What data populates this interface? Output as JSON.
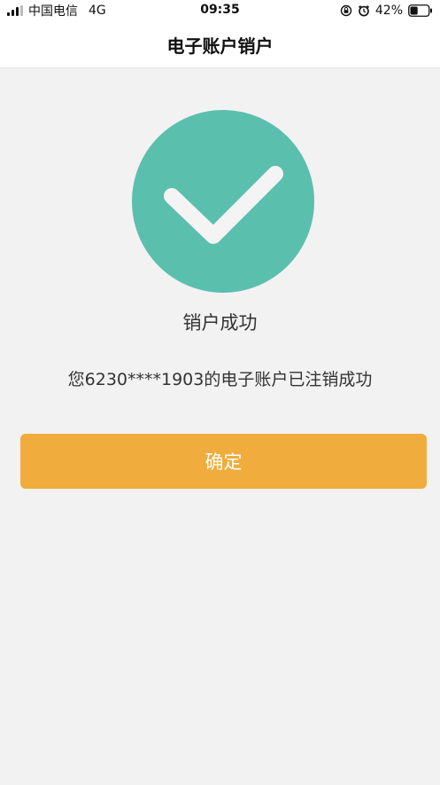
{
  "status_bar": {
    "carrier": "中国电信",
    "network": "4G",
    "time": "09:35",
    "battery_percent": "42%",
    "battery_level": 0.42,
    "icons": [
      "signal-icon",
      "rotation-lock-icon",
      "alarm-icon",
      "battery-icon"
    ]
  },
  "nav": {
    "title": "电子账户销户"
  },
  "result": {
    "icon": "check-circle-icon",
    "icon_color": "#5bbfad",
    "title": "销户成功",
    "message": "您6230****1903的电子账户已注销成功"
  },
  "actions": {
    "confirm_label": "确定",
    "confirm_color": "#f0ac3c"
  }
}
